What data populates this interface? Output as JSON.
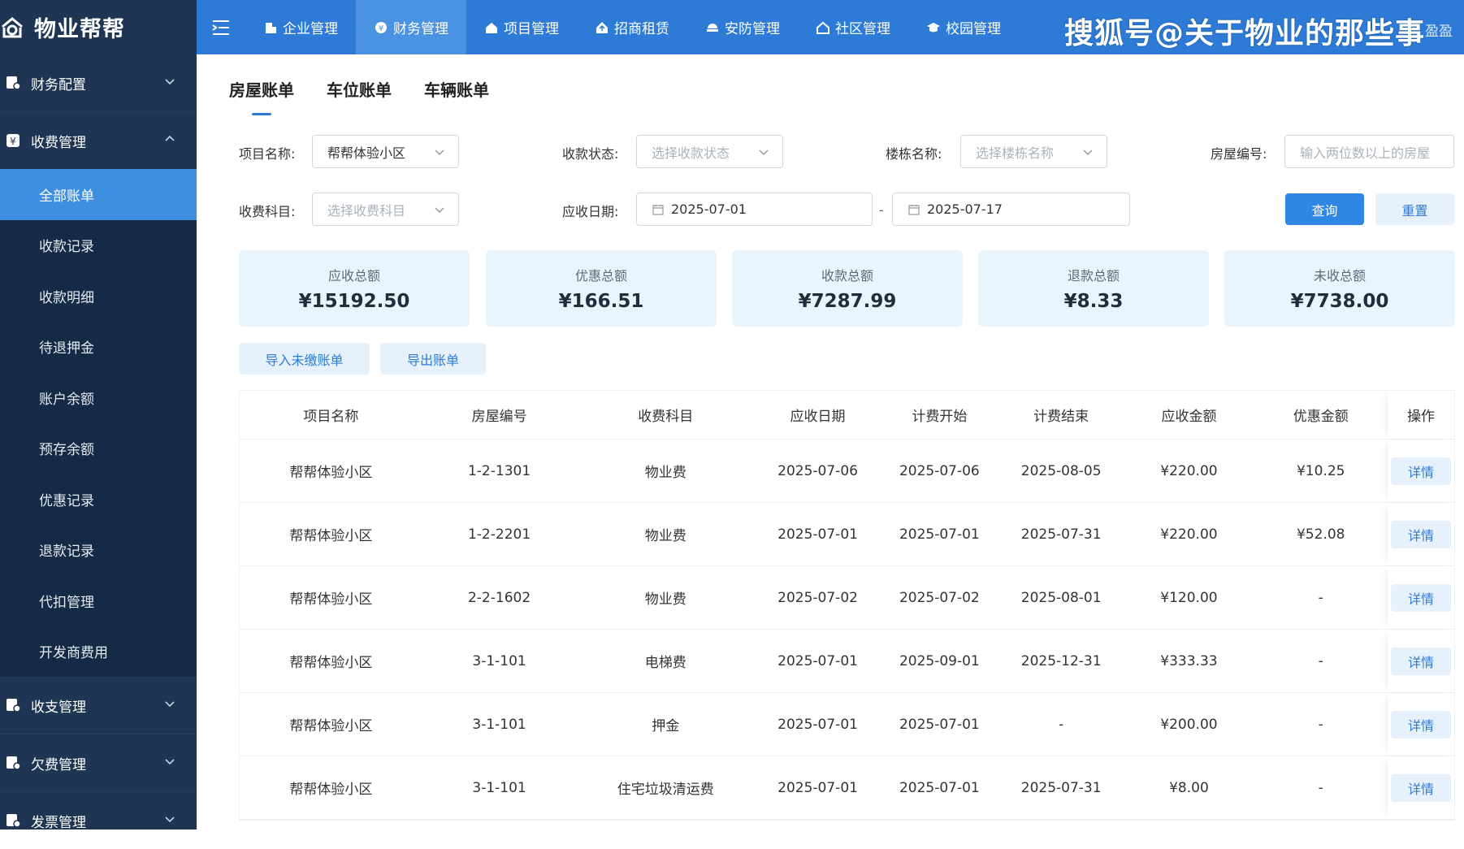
{
  "app": {
    "logo_text": "物业帮帮"
  },
  "sidebar": {
    "groups": [
      {
        "label": "财务配置",
        "icon": "finance-config-icon",
        "expanded": false
      },
      {
        "label": "收费管理",
        "icon": "charge-icon",
        "expanded": true,
        "items": [
          "全部账单",
          "收款记录",
          "收款明细",
          "待退押金",
          "账户余额",
          "预存余额",
          "优惠记录",
          "退款记录",
          "代扣管理",
          "开发商费用"
        ],
        "active_item": "全部账单"
      },
      {
        "label": "收支管理",
        "icon": "income-expense-icon",
        "expanded": false
      },
      {
        "label": "欠费管理",
        "icon": "arrears-icon",
        "expanded": false
      },
      {
        "label": "发票管理",
        "icon": "invoice-icon",
        "expanded": false
      }
    ]
  },
  "topnav": {
    "items": [
      {
        "label": "企业管理",
        "icon": "building-icon"
      },
      {
        "label": "财务管理",
        "icon": "yen-icon",
        "active": true
      },
      {
        "label": "项目管理",
        "icon": "home-icon"
      },
      {
        "label": "招商租赁",
        "icon": "house-upload-icon"
      },
      {
        "label": "安防管理",
        "icon": "security-camera-icon"
      },
      {
        "label": "社区管理",
        "icon": "community-icon"
      },
      {
        "label": "校园管理",
        "icon": "graduation-cap-icon"
      }
    ],
    "watermark": "搜狐号@关于物业的那些事",
    "user_tail": "盈盈"
  },
  "tabs": [
    "房屋账单",
    "车位账单",
    "车辆账单"
  ],
  "filters": {
    "project_label": "项目名称:",
    "project_value": "帮帮体验小区",
    "status_label": "收款状态:",
    "status_placeholder": "选择收款状态",
    "building_label": "楼栋名称:",
    "building_placeholder": "选择楼栋名称",
    "house_label": "房屋编号:",
    "house_placeholder": "输入两位数以上的房屋",
    "subject_label": "收费科目:",
    "subject_placeholder": "选择收费科目",
    "date_label": "应收日期:",
    "date_start": "2025-07-01",
    "date_sep": "-",
    "date_end": "2025-07-17",
    "query_label": "查询",
    "reset_label": "重置"
  },
  "stats": [
    {
      "label": "应收总额",
      "value": "¥15192.50"
    },
    {
      "label": "优惠总额",
      "value": "¥166.51"
    },
    {
      "label": "收款总额",
      "value": "¥7287.99"
    },
    {
      "label": "退款总额",
      "value": "¥8.33"
    },
    {
      "label": "未收总额",
      "value": "¥7738.00"
    }
  ],
  "actions": {
    "import_label": "导入未缴账单",
    "export_label": "导出账单"
  },
  "table": {
    "headers": [
      "项目名称",
      "房屋编号",
      "收费科目",
      "应收日期",
      "计费开始",
      "计费结束",
      "应收金额",
      "优惠金额",
      "操作"
    ],
    "detail_label": "详情",
    "rows": [
      [
        "帮帮体验小区",
        "1-2-1301",
        "物业费",
        "2025-07-06",
        "2025-07-06",
        "2025-08-05",
        "¥220.00",
        "¥10.25"
      ],
      [
        "帮帮体验小区",
        "1-2-2201",
        "物业费",
        "2025-07-01",
        "2025-07-01",
        "2025-07-31",
        "¥220.00",
        "¥52.08"
      ],
      [
        "帮帮体验小区",
        "2-2-1602",
        "物业费",
        "2025-07-02",
        "2025-07-02",
        "2025-08-01",
        "¥120.00",
        "-"
      ],
      [
        "帮帮体验小区",
        "3-1-101",
        "电梯费",
        "2025-07-01",
        "2025-09-01",
        "2025-12-31",
        "¥333.33",
        "-"
      ],
      [
        "帮帮体验小区",
        "3-1-101",
        "押金",
        "2025-07-01",
        "2025-07-01",
        "-",
        "¥200.00",
        "-"
      ],
      [
        "帮帮体验小区",
        "3-1-101",
        "住宅垃圾清运费",
        "2025-07-01",
        "2025-07-01",
        "2025-07-31",
        "¥8.00",
        "-"
      ]
    ]
  },
  "colors": {
    "sidebar": "#1e3553",
    "topbar": "#2d7bd6",
    "active": "#3f8fe0",
    "card": "#eaf4fd"
  }
}
